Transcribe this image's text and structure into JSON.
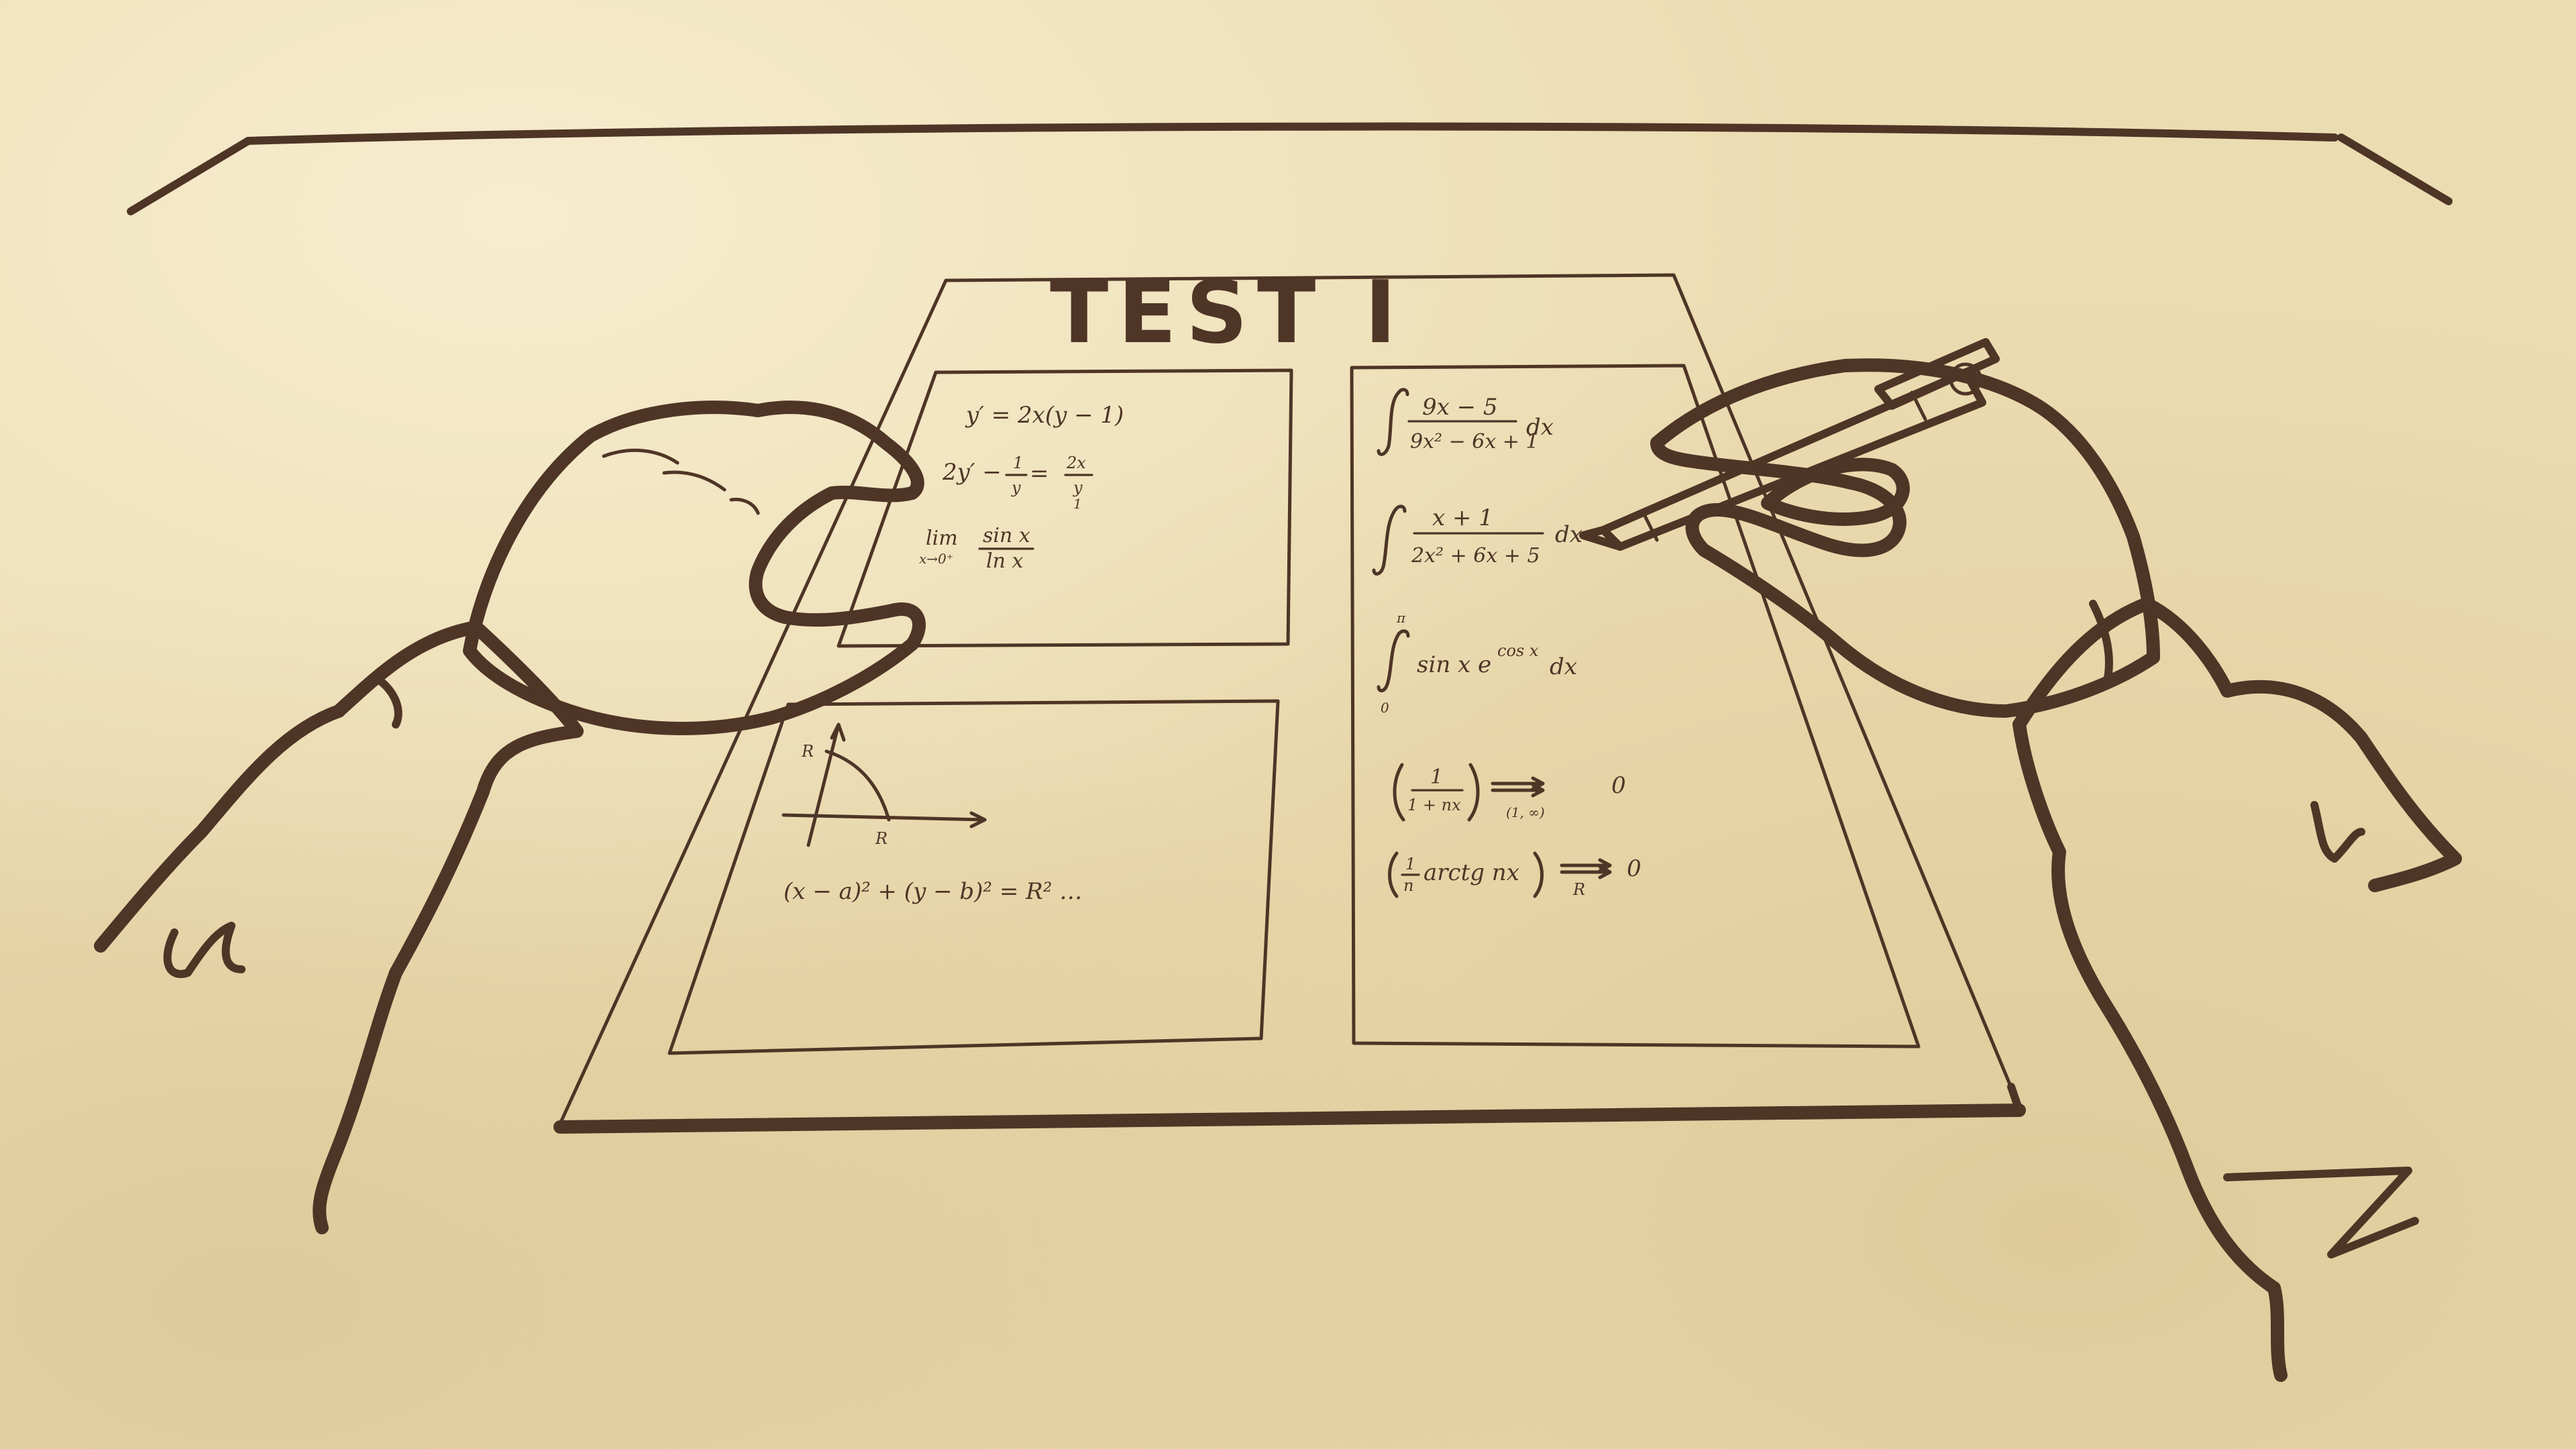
{
  "test_sheet": {
    "title": "TEST I",
    "panel_top_left": {
      "eq_1": "y′ = 2x(y − 1)",
      "eq_2_lhs": "2y′ − ",
      "eq_2_frac_num": "1",
      "eq_2_frac_den": "y",
      "eq_2_mid": " = ",
      "eq_2_rhs_num": "2x",
      "eq_2_rhs_den": "y",
      "eq_2_rhs_extra": "1",
      "limit_word": "lim",
      "limit_sub": "x→0⁺",
      "limit_num": "sin x",
      "limit_den": "ln x"
    },
    "panel_bottom_left": {
      "axis_label_y": "R",
      "axis_label_x": "R",
      "circle_eq": "(x − a)² + (y − b)² = R² …"
    },
    "panel_right": {
      "int_1_num": "9x − 5",
      "int_1_den": "9x² − 6x + 1",
      "int_1_dx": "dx",
      "int_2_num": "x + 1",
      "int_2_den": "2x² + 6x + 5",
      "int_2_dx": "dx",
      "int_3_upper": "π",
      "int_3_lower": "0",
      "int_3_body": "sin x e",
      "int_3_exp": "cos x",
      "int_3_dx": "dx",
      "seq_1_num": "1",
      "seq_1_den": "1 + nx",
      "seq_1_under": "(1, ∞)",
      "seq_1_limit": "0",
      "seq_2_frac_num": "1",
      "seq_2_frac_den": "n",
      "seq_2_body": "arctg nx",
      "seq_2_under": "R",
      "seq_2_limit": "0"
    }
  },
  "colors": {
    "paper_background": "#ecdcb2",
    "ink": "#4e3526"
  }
}
